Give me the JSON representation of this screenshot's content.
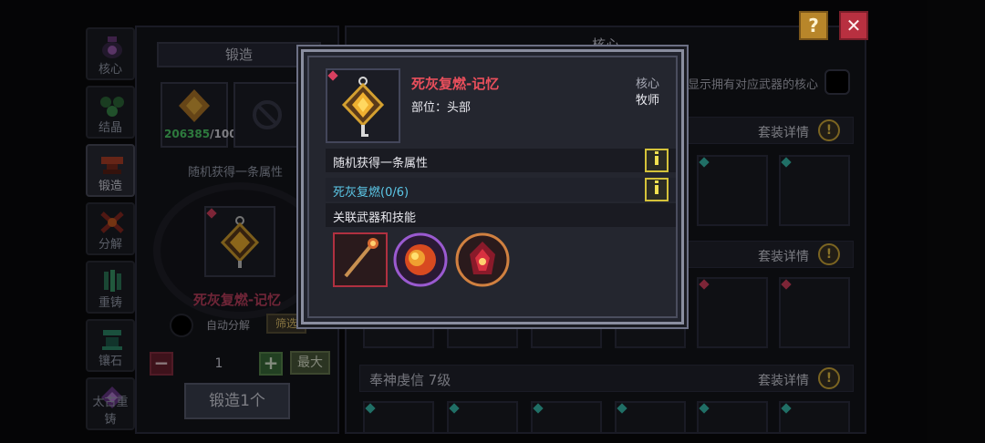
{
  "nav": {
    "items": [
      {
        "label": "核心"
      },
      {
        "label": "结晶"
      },
      {
        "label": "锻造"
      },
      {
        "label": "分解"
      },
      {
        "label": "重铸"
      },
      {
        "label": "镶石"
      },
      {
        "label": "太古重铸"
      }
    ],
    "active_index": 2
  },
  "forge": {
    "tab_label": "锻造",
    "material_have": "206385",
    "material_need": "/100",
    "random_attr_label": "随机获得一条属性",
    "result_name": "死灰复燃-记忆",
    "auto_decompose_label": "自动分解",
    "filter_label": "筛选",
    "minus_label": "−",
    "quantity": "1",
    "plus_label": "+",
    "max_label": "最大",
    "forge_button_label": "锻造1个"
  },
  "core_panel": {
    "title": "核心",
    "own_toggle_label": "显示拥有对应武器的核心",
    "sets": [
      {
        "name": "",
        "detail": "套装详情",
        "badge": "!"
      },
      {
        "name": "",
        "detail": "套装详情",
        "badge": "!"
      },
      {
        "name": "奉神虔信  7级",
        "detail": "套装详情",
        "badge": "!"
      }
    ]
  },
  "controls": {
    "help_label": "?",
    "close_label": "✕"
  },
  "popup": {
    "name": "死灰复燃-记忆",
    "part": "部位：头部",
    "type": "核心",
    "class": "牧师",
    "random_attr": "随机获得一条属性",
    "set_progress": "死灰复燃(0/6)",
    "related_label": "关联武器和技能"
  },
  "colors": {
    "item_name": "#ea4f5c",
    "set_progress": "#5cc8e8",
    "material_have": "#4fd16a",
    "accent_gold": "#d4ad3a"
  }
}
